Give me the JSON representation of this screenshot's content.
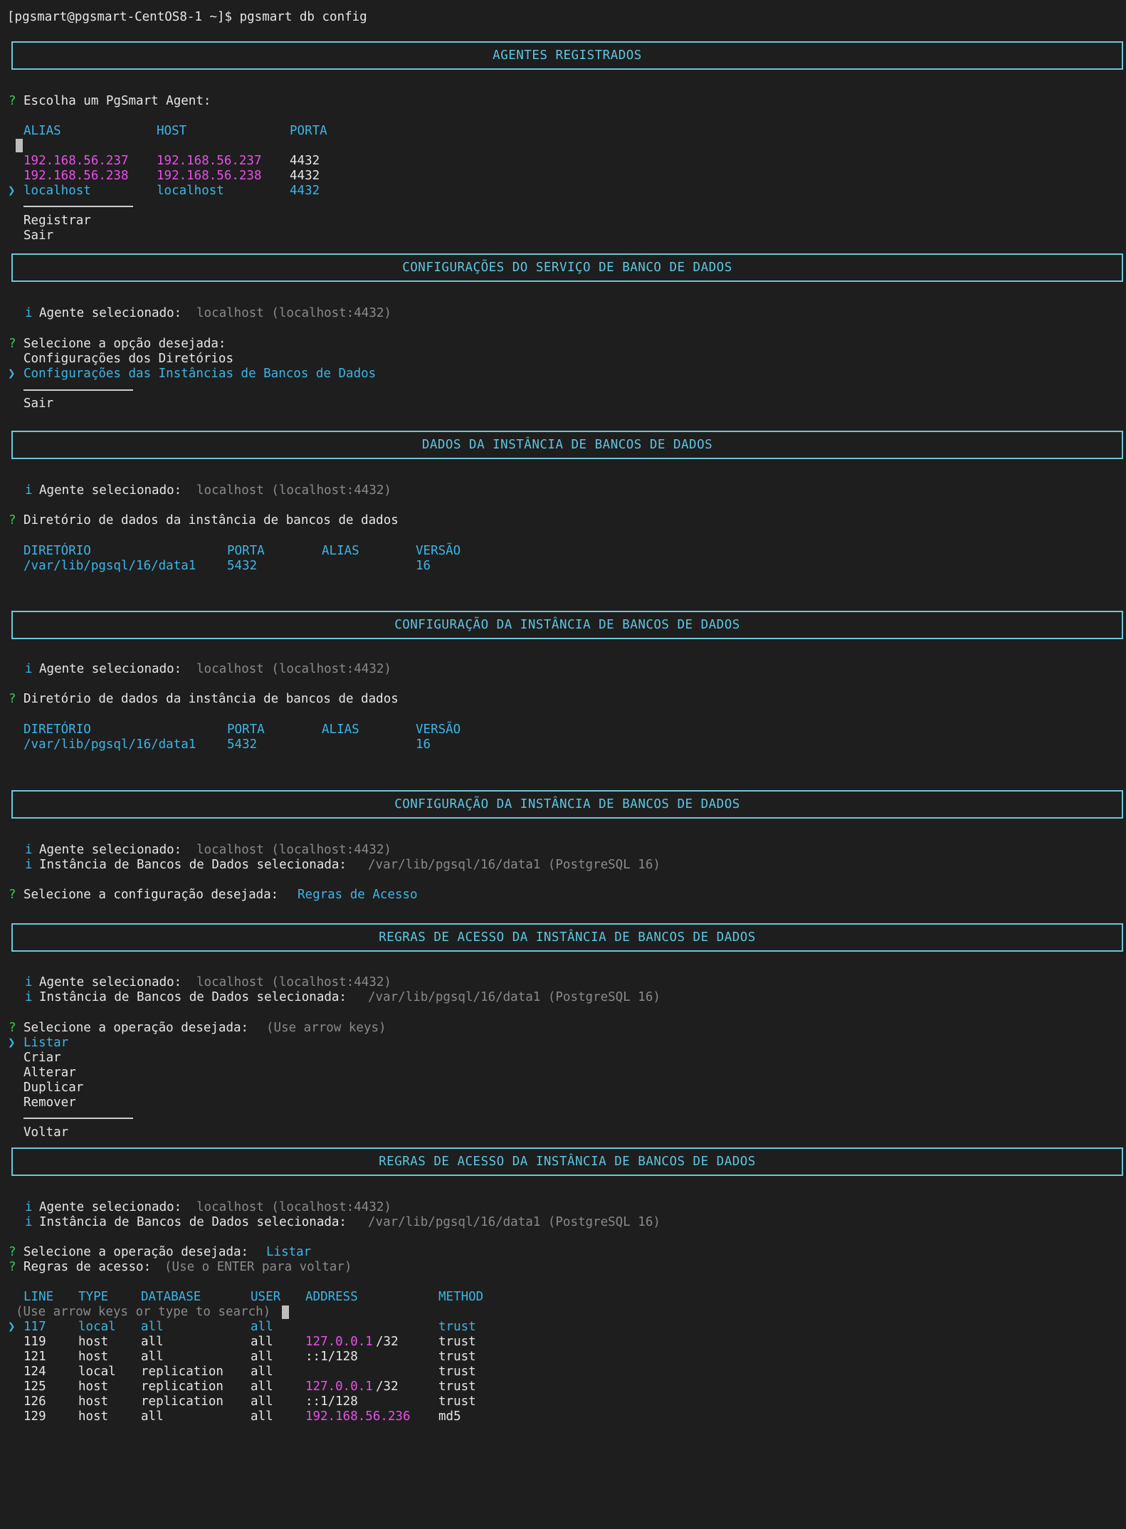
{
  "prompt_line": {
    "text": "[pgsmart@pgsmart-CentOS8-1 ~]$ pgsmart db config"
  },
  "symbols": {
    "question": "?",
    "pointer": "❯",
    "info": "i"
  },
  "section_agents": {
    "title": "AGENTES REGISTRADOS",
    "question": "Escolha um PgSmart Agent:",
    "headers": [
      "ALIAS",
      "HOST",
      "PORTA"
    ],
    "rows": [
      {
        "alias": "192.168.56.237",
        "host": "192.168.56.237",
        "port": "4432"
      },
      {
        "alias": "192.168.56.238",
        "host": "192.168.56.238",
        "port": "4432"
      },
      {
        "alias": "localhost",
        "host": "localhost",
        "port": "4432"
      }
    ],
    "extra_options": [
      "Registrar",
      "Sair"
    ]
  },
  "section_service": {
    "title": "CONFIGURAÇÕES DO SERVIÇO DE BANCO DE DADOS",
    "agent_label": "Agente selecionado:",
    "agent_value": "localhost (localhost:4432)",
    "question": "Selecione a opção desejada:",
    "options": [
      "Configurações dos Diretórios",
      "Configurações das Instâncias de Bancos de Dados"
    ],
    "extra_options": [
      "Sair"
    ]
  },
  "section_data1": {
    "title": "DADOS DA INSTÂNCIA DE BANCOS DE DADOS",
    "agent_label": "Agente selecionado:",
    "agent_value": "localhost (localhost:4432)",
    "question": "Diretório de dados da instância de bancos de dados",
    "headers": [
      "DIRETÓRIO",
      "PORTA",
      "ALIAS",
      "VERSÃO"
    ],
    "row": {
      "dir": "/var/lib/pgsql/16/data1",
      "port": "5432",
      "alias": "",
      "version": "16"
    }
  },
  "section_data2": {
    "title": "CONFIGURAÇÃO DA INSTÂNCIA DE BANCOS DE DADOS",
    "agent_label": "Agente selecionado:",
    "agent_value": "localhost (localhost:4432)",
    "question": "Diretório de dados da instância de bancos de dados",
    "headers": [
      "DIRETÓRIO",
      "PORTA",
      "ALIAS",
      "VERSÃO"
    ],
    "row": {
      "dir": "/var/lib/pgsql/16/data1",
      "port": "5432",
      "alias": "",
      "version": "16"
    }
  },
  "section_config": {
    "title": "CONFIGURAÇÃO DA INSTÂNCIA DE BANCOS DE DADOS",
    "agent_label": "Agente selecionado:",
    "agent_value": "localhost (localhost:4432)",
    "instance_label": "Instância de Bancos de Dados selecionada:",
    "instance_value": "/var/lib/pgsql/16/data1 (PostgreSQL 16)",
    "question": "Selecione a configuração desejada:",
    "answer": "Regras de Acesso"
  },
  "section_rules1": {
    "title": "REGRAS DE ACESSO DA INSTÂNCIA DE BANCOS DE DADOS",
    "agent_label": "Agente selecionado:",
    "agent_value": "localhost (localhost:4432)",
    "instance_label": "Instância de Bancos de Dados selecionada:",
    "instance_value": "/var/lib/pgsql/16/data1 (PostgreSQL 16)",
    "question": "Selecione a operação desejada:",
    "hint": "(Use arrow keys)",
    "options": [
      "Listar",
      "Criar",
      "Alterar",
      "Duplicar",
      "Remover"
    ],
    "extra_options": [
      "Voltar"
    ]
  },
  "section_rules2": {
    "title": "REGRAS DE ACESSO DA INSTÂNCIA DE BANCOS DE DADOS",
    "agent_label": "Agente selecionado:",
    "agent_value": "localhost (localhost:4432)",
    "instance_label": "Instância de Bancos de Dados selecionada:",
    "instance_value": "/var/lib/pgsql/16/data1 (PostgreSQL 16)",
    "question": "Selecione a operação desejada:",
    "answer": "Listar",
    "rules_question": "Regras de acesso:",
    "rules_hint": "(Use o ENTER para voltar)",
    "headers": [
      "LINE",
      "TYPE",
      "DATABASE",
      "USER",
      "ADDRESS",
      "METHOD"
    ],
    "search_hint": "(Use arrow keys or type to search)",
    "rules": [
      {
        "line": "117",
        "type": "local",
        "database": "all",
        "user": "all",
        "addr_ip": "",
        "addr_mask": "",
        "method": "trust"
      },
      {
        "line": "119",
        "type": "host",
        "database": "all",
        "user": "all",
        "addr_ip": "127.0.0.1",
        "addr_mask": "/32",
        "method": "trust"
      },
      {
        "line": "121",
        "type": "host",
        "database": "all",
        "user": "all",
        "addr_ip": "",
        "addr_mask": "::1/128",
        "method": "trust"
      },
      {
        "line": "124",
        "type": "local",
        "database": "replication",
        "user": "all",
        "addr_ip": "",
        "addr_mask": "",
        "method": "trust"
      },
      {
        "line": "125",
        "type": "host",
        "database": "replication",
        "user": "all",
        "addr_ip": "127.0.0.1",
        "addr_mask": "/32",
        "method": "trust"
      },
      {
        "line": "126",
        "type": "host",
        "database": "replication",
        "user": "all",
        "addr_ip": "",
        "addr_mask": "::1/128",
        "method": "trust"
      },
      {
        "line": "129",
        "type": "host",
        "database": "all",
        "user": "all",
        "addr_ip": "192.168.56.236",
        "addr_mask": "",
        "method": "md5"
      }
    ]
  },
  "colors": {
    "background": "#1e1e1e",
    "text": "#e6e6e6",
    "cyan": "#3cb5e6",
    "magenta": "#e94fe9",
    "green": "#34d058",
    "gray": "#8a8a8a",
    "box_border": "#6fc6d6"
  }
}
